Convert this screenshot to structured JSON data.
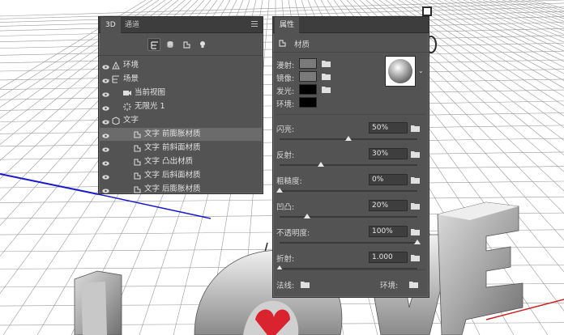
{
  "panel3d": {
    "tabs": [
      {
        "label": "3D"
      },
      {
        "label": "通道"
      }
    ],
    "layers": [
      {
        "label": "环境",
        "icon": "environment-icon"
      },
      {
        "label": "场景",
        "icon": "scene-icon"
      },
      {
        "label": "当前视图",
        "icon": "camera-icon"
      },
      {
        "label": "无限光 1",
        "icon": "light-icon"
      },
      {
        "label": "文字",
        "icon": "mesh-icon"
      },
      {
        "label": "文字 前膨胀材质",
        "icon": "material-icon",
        "selected": true
      },
      {
        "label": "文字 前斜面材质",
        "icon": "material-icon"
      },
      {
        "label": "文字 凸出材质",
        "icon": "material-icon"
      },
      {
        "label": "文字 后斜面材质",
        "icon": "material-icon"
      },
      {
        "label": "文字 后膨胀材质",
        "icon": "material-icon"
      }
    ]
  },
  "props": {
    "tab": "属性",
    "subtitle": "材质",
    "colors": [
      {
        "label": "漫射:",
        "color": "#7a7a7a"
      },
      {
        "label": "镜像:",
        "color": "#7a7a7a"
      },
      {
        "label": "发光:",
        "color": "#000000"
      },
      {
        "label": "环境:",
        "color": "#000000"
      }
    ],
    "params": [
      {
        "label": "闪亮:",
        "value": "50%",
        "level": 0.5
      },
      {
        "label": "反射:",
        "value": "30%",
        "level": 0.3
      },
      {
        "label": "粗糙度:",
        "value": "0%",
        "level": 0.0
      },
      {
        "label": "凹凸:",
        "value": "20%",
        "level": 0.2
      },
      {
        "label": "不透明度:",
        "value": "100%",
        "level": 1.0
      },
      {
        "label": "折射:",
        "value": "1.000",
        "level": 0.0
      }
    ],
    "normal_label": "法线:",
    "env_label": "环境:"
  }
}
